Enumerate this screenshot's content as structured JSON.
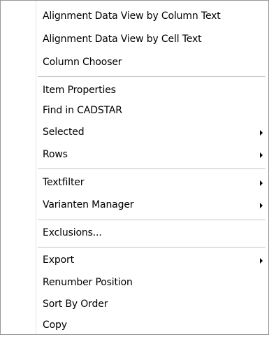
{
  "menu": {
    "items": [
      {
        "label": "Alignment Data View by Column Text",
        "submenu": false
      },
      {
        "label": "Alignment Data View by Cell Text",
        "submenu": false
      },
      {
        "label": "Column Chooser",
        "submenu": false
      },
      {
        "label": "Item Properties",
        "submenu": false
      },
      {
        "label": "Find in CADSTAR",
        "submenu": false
      },
      {
        "label": "Selected",
        "submenu": true
      },
      {
        "label": "Rows",
        "submenu": true
      },
      {
        "label": "Textfilter",
        "submenu": true
      },
      {
        "label": "Varianten Manager",
        "submenu": true
      },
      {
        "label": "Exclusions...",
        "submenu": false
      },
      {
        "label": "Export",
        "submenu": true
      },
      {
        "label": "Renumber Position",
        "submenu": false
      },
      {
        "label": "Sort By Order",
        "submenu": false
      },
      {
        "label": "Copy",
        "submenu": false
      }
    ]
  }
}
